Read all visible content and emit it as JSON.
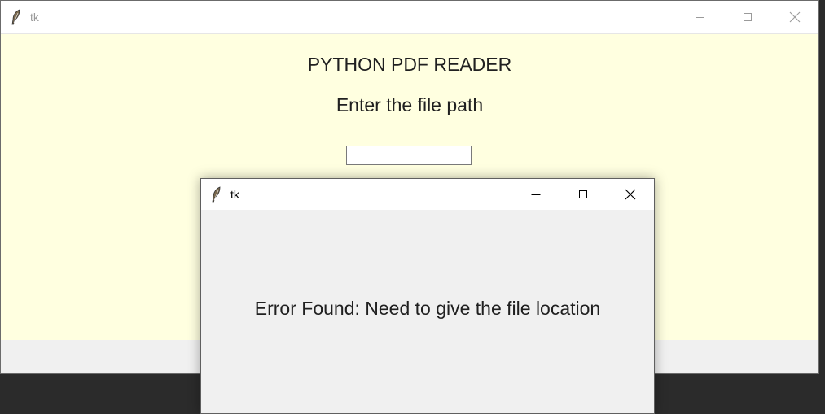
{
  "main_window": {
    "title": "tk",
    "app_title": "PYTHON PDF READER",
    "prompt_label": "Enter the file path",
    "path_input": {
      "value": "",
      "placeholder": ""
    },
    "colors": {
      "client_bg": "#ffffe0",
      "window_bg": "#f0f0f0"
    }
  },
  "dialog": {
    "title": "tk",
    "message": "Error Found: Need to give the file location"
  },
  "icons": {
    "app_icon": "feather-icon",
    "minimize": "minimize-icon",
    "maximize": "maximize-icon",
    "close": "close-icon"
  }
}
